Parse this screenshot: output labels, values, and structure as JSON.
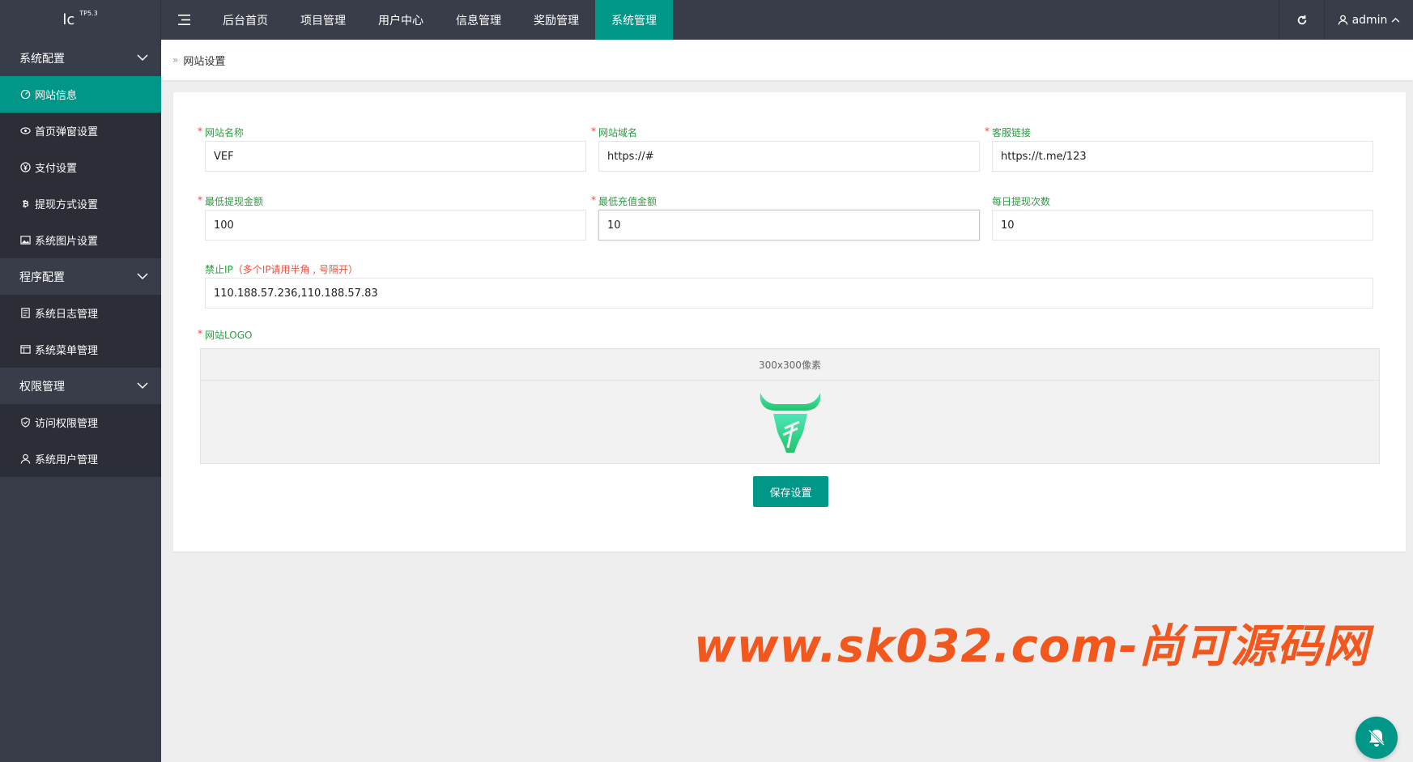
{
  "logo": {
    "text": "lc",
    "version": "TP5.3"
  },
  "header": {
    "nav": [
      "后台首页",
      "项目管理",
      "用户中心",
      "信息管理",
      "奖励管理",
      "系统管理"
    ],
    "active_index": 5,
    "user": "admin"
  },
  "sidebar": {
    "groups": [
      {
        "label": "系统配置",
        "items": [
          "网站信息",
          "首页弹窗设置",
          "支付设置",
          "提现方式设置",
          "系统图片设置"
        ]
      },
      {
        "label": "程序配置",
        "items": [
          "系统日志管理",
          "系统菜单管理"
        ]
      },
      {
        "label": "权限管理",
        "items": [
          "访问权限管理",
          "系统用户管理"
        ]
      }
    ]
  },
  "breadcrumb": {
    "current": "网站设置"
  },
  "form": {
    "site_name": {
      "label": "网站名称",
      "value": "VEF"
    },
    "site_domain": {
      "label": "网站域名",
      "value": "https://#"
    },
    "service_link": {
      "label": "客服链接",
      "value": "https://t.me/123"
    },
    "min_withdraw": {
      "label": "最低提现金额",
      "value": "100"
    },
    "min_recharge": {
      "label": "最低充值金额",
      "value": "10"
    },
    "daily_withdraw": {
      "label": "每日提现次数",
      "value": "10"
    },
    "ban_ip": {
      "label": "禁止IP",
      "hint": "（多个IP请用半角 , 号隔开）",
      "value": "110.188.57.236,110.188.57.83"
    },
    "logo": {
      "label": "网站LOGO",
      "size_hint": "300x300像素"
    },
    "save_label": "保存设置"
  },
  "watermark": "www.sk032.com-尚可源码网",
  "colors": {
    "accent": "#009688",
    "topbar": "#393d49",
    "sub_bg": "#2b2e37",
    "label_green": "#2a9d3f",
    "required_red": "#ff3b3b",
    "watermark": "#f2571e"
  }
}
